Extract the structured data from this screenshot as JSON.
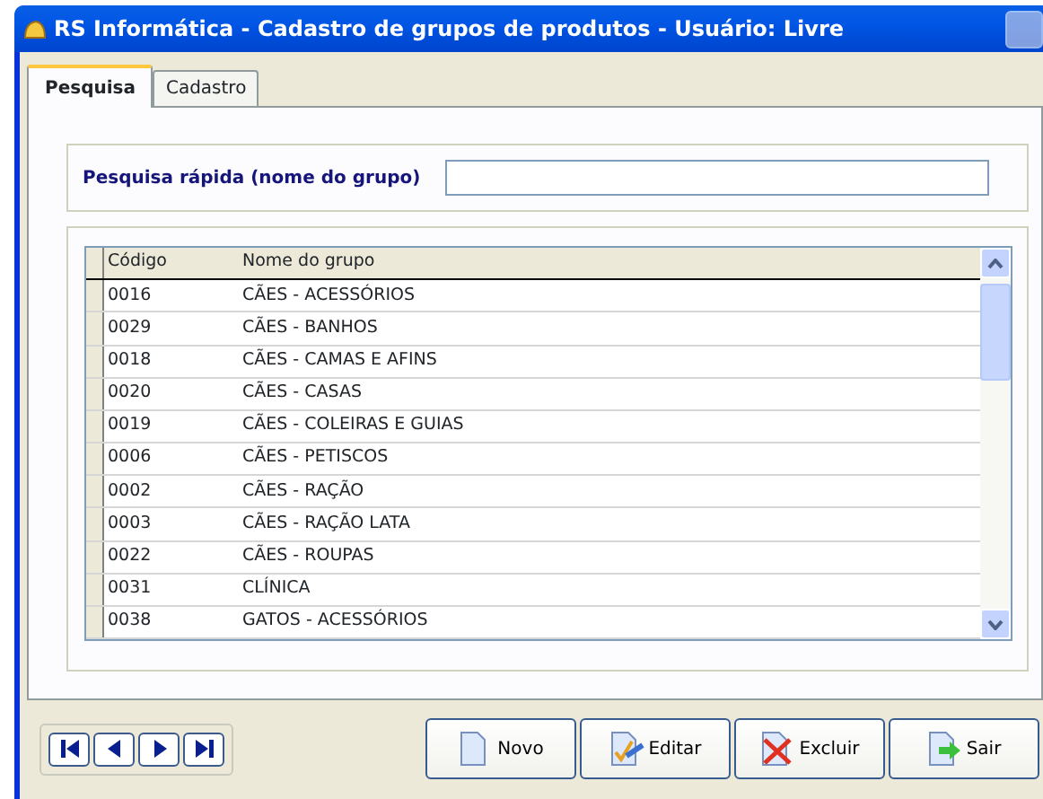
{
  "window": {
    "title": "RS Informática - Cadastro de grupos de produtos - Usuário: Livre"
  },
  "tabs": [
    {
      "label": "Pesquisa",
      "selected": true
    },
    {
      "label": "Cadastro",
      "selected": false
    }
  ],
  "search": {
    "label": "Pesquisa rápida (nome do grupo)"
  },
  "table": {
    "columns": [
      "Código",
      "Nome do grupo"
    ],
    "rows": [
      [
        "0016",
        "CÃES - ACESSÓRIOS"
      ],
      [
        "0029",
        "CÃES - BANHOS"
      ],
      [
        "0018",
        "CÃES - CAMAS E AFINS"
      ],
      [
        "0020",
        "CÃES - CASAS"
      ],
      [
        "0019",
        "CÃES - COLEIRAS E GUIAS"
      ],
      [
        "0006",
        "CÃES - PETISCOS"
      ],
      [
        "0002",
        "CÃES - RAÇÃO"
      ],
      [
        "0003",
        "CÃES - RAÇÃO LATA"
      ],
      [
        "0022",
        "CÃES - ROUPAS"
      ],
      [
        "0031",
        "CLÍNICA"
      ],
      [
        "0038",
        "GATOS - ACESSÓRIOS"
      ]
    ]
  },
  "navigator": [
    {
      "kind": "first"
    },
    {
      "kind": "prev"
    },
    {
      "kind": "next"
    },
    {
      "kind": "last"
    }
  ],
  "buttons": [
    {
      "kind": "new",
      "label": "Novo"
    },
    {
      "kind": "edit",
      "label": "Editar"
    },
    {
      "kind": "delete",
      "label": "Excluir"
    },
    {
      "kind": "exit",
      "label": "Sair"
    }
  ]
}
